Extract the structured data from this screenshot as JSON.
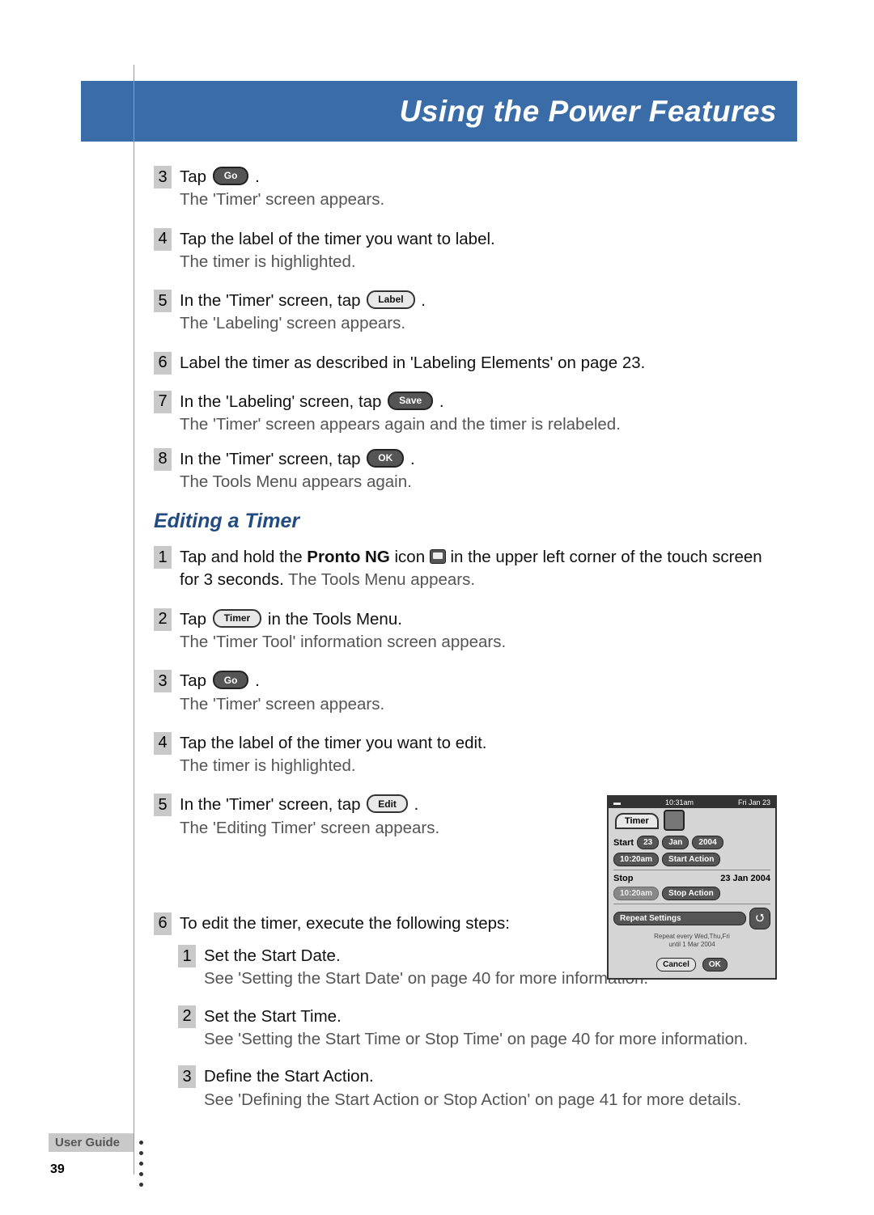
{
  "header": {
    "title": "Using the Power Features"
  },
  "buttons": {
    "go": "Go",
    "label": "Label",
    "save": "Save",
    "ok": "OK",
    "timer": "Timer",
    "edit": "Edit"
  },
  "stepsA": [
    {
      "num": "3",
      "main_pre": "Tap ",
      "btn": "go",
      "main_post": " .",
      "sub": "The 'Timer' screen appears."
    },
    {
      "num": "4",
      "main": "Tap the label of the timer you want to label.",
      "sub": "The timer is highlighted."
    },
    {
      "num": "5",
      "main_pre": "In the 'Timer' screen, tap ",
      "btn": "label",
      "main_post": " .",
      "sub": "The 'Labeling' screen appears."
    },
    {
      "num": "6",
      "main": "Label the timer as described in 'Labeling Elements' on page 23."
    },
    {
      "num": "7",
      "main_pre": "In the 'Labeling' screen, tap ",
      "btn": "save",
      "btn_dark": true,
      "main_post": " .",
      "sub": "The 'Timer' screen appears again and the timer is relabeled."
    },
    {
      "num": "8",
      "main_pre": "In the 'Timer' screen, tap ",
      "btn": "ok",
      "btn_dark": true,
      "main_post": " .",
      "sub": "The Tools Menu appears again."
    }
  ],
  "section2": {
    "heading": "Editing a Timer"
  },
  "stepsB": {
    "s1": {
      "num": "1",
      "pre": "Tap and hold the ",
      "bold": "Pronto NG",
      "mid": " icon ",
      "post": " in the upper left corner of the touch screen for 3 seconds. ",
      "sub": "The Tools Menu appears."
    },
    "s2": {
      "num": "2",
      "pre": "Tap ",
      "post": " in the Tools Menu.",
      "sub": "The 'Timer Tool' information screen appears."
    },
    "s3": {
      "num": "3",
      "pre": "Tap ",
      "post": " .",
      "sub": "The 'Timer' screen appears."
    },
    "s4": {
      "num": "4",
      "main": "Tap the label of the timer you want to edit.",
      "sub": "The timer is highlighted."
    },
    "s5": {
      "num": "5",
      "pre": "In the 'Timer' screen, tap ",
      "post": " .",
      "sub": "The 'Editing Timer' screen appears."
    },
    "s6": {
      "num": "6",
      "main": "To edit the timer, execute the following steps:"
    }
  },
  "substeps": [
    {
      "num": "1",
      "main": "Set the Start Date.",
      "sub": "See 'Setting the Start Date' on page 40 for more information."
    },
    {
      "num": "2",
      "main": "Set the Start Time.",
      "sub": "See 'Setting the Start Time or Stop Time' on page 40 for more information."
    },
    {
      "num": "3",
      "main": "Define the Start Action.",
      "sub": "See 'Defining the Start Action or Stop Action' on page 41 for more details."
    }
  ],
  "timer_widget": {
    "time": "10:31am",
    "date": "Fri Jan 23",
    "tab": "Timer",
    "start": "Start",
    "day": "23",
    "month": "Jan",
    "year": "2004",
    "start_time": "10:20am",
    "start_action": "Start Action",
    "stop": "Stop",
    "stop_date": "23 Jan 2004",
    "stop_time": "10:20am",
    "stop_action": "Stop Action",
    "repeat": "Repeat Settings",
    "repeat_text1": "Repeat every Wed,Thu,Fri",
    "repeat_text2": "until 1 Mar 2004",
    "cancel": "Cancel",
    "ok": "OK"
  },
  "footer": {
    "label": "User Guide",
    "page": "39"
  }
}
